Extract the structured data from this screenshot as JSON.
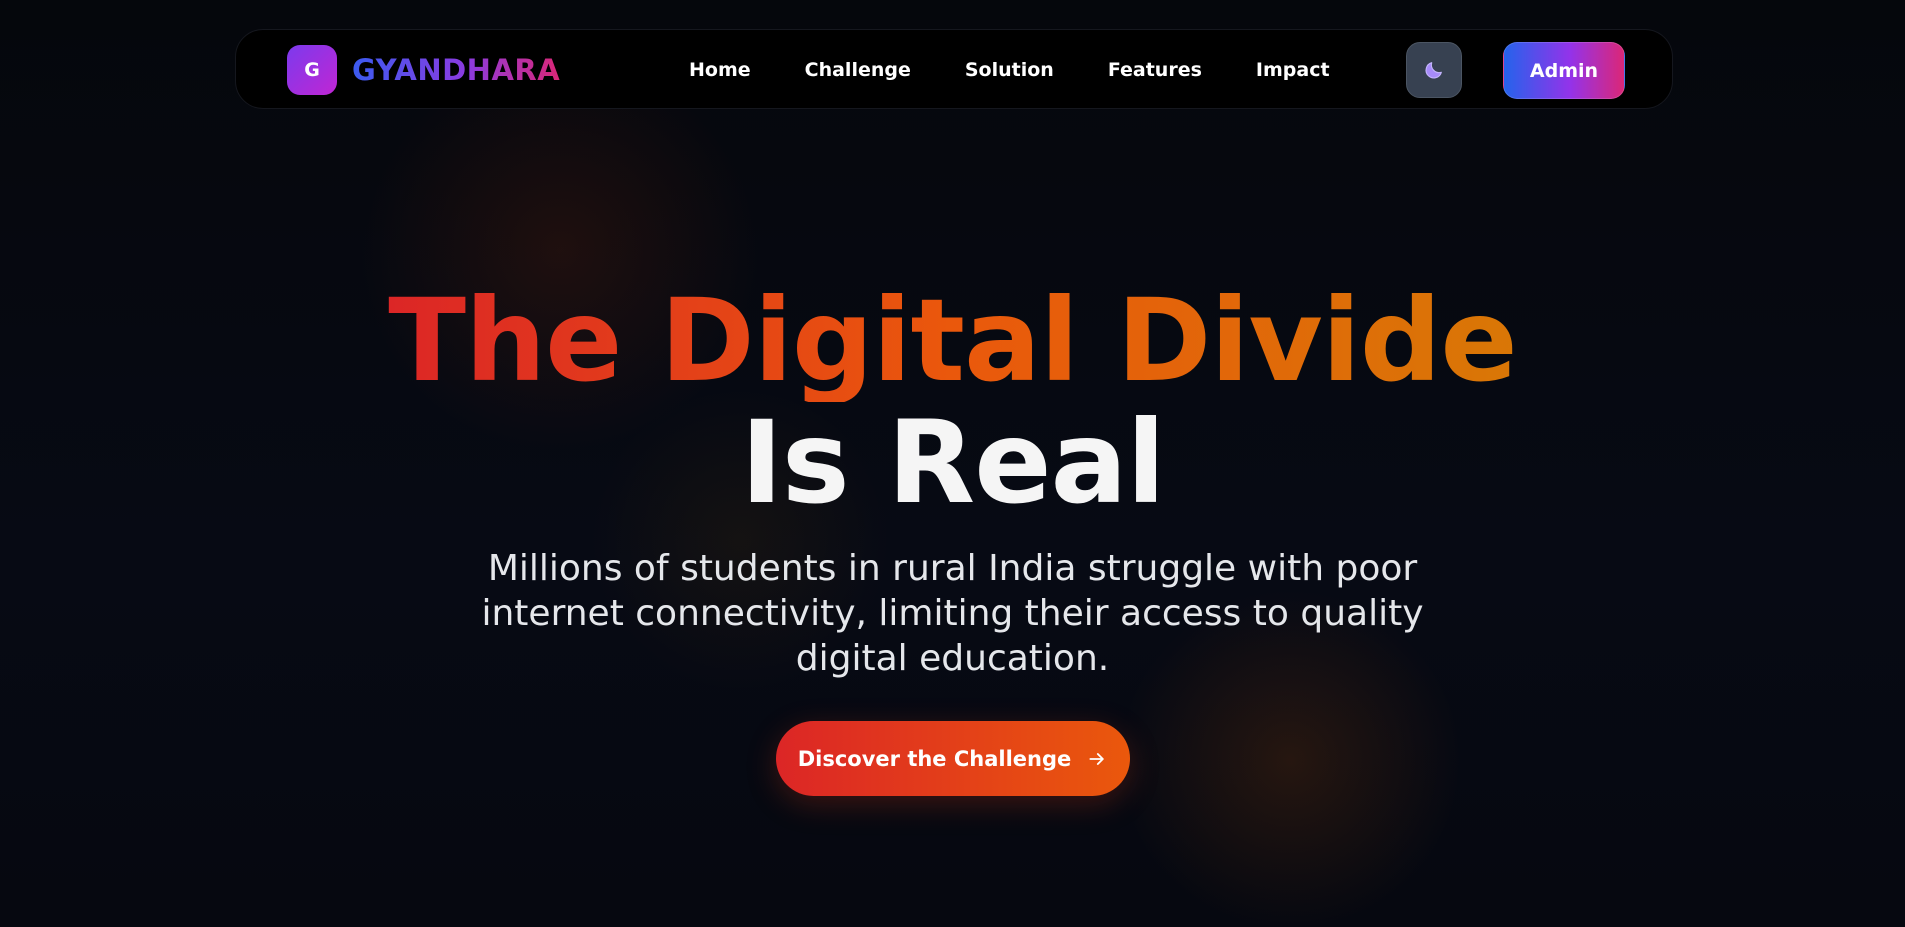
{
  "brand": {
    "logo_letter": "G",
    "name": "GYANDHARA"
  },
  "nav": {
    "links": [
      {
        "label": "Home"
      },
      {
        "label": "Challenge"
      },
      {
        "label": "Solution"
      },
      {
        "label": "Features"
      },
      {
        "label": "Impact"
      }
    ],
    "theme_toggle_icon": "moon-icon",
    "admin_label": "Admin"
  },
  "hero": {
    "headline_line1": "The Digital Divide",
    "headline_line2": "Is Real",
    "subtitle": "Millions of students in rural India struggle with poor internet connectivity, limiting their access to quality digital education.",
    "cta_label": "Discover the Challenge",
    "cta_icon": "arrow-right-icon"
  },
  "colors": {
    "background": "#05070c",
    "accent_red": "#dc2626",
    "accent_orange": "#ea580c",
    "accent_amber": "#d97706",
    "brand_blue": "#3b5bf0",
    "brand_purple": "#9333ea",
    "brand_pink": "#db2777"
  }
}
